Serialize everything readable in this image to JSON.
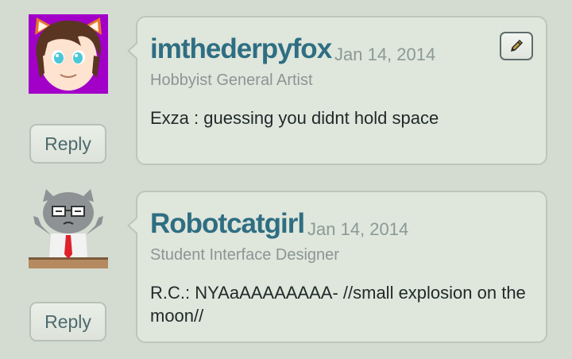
{
  "comments": [
    {
      "username": "imthederpyfox",
      "date": "Jan 14, 2014",
      "role": "Hobbyist General Artist",
      "body": "Exza : guessing you didnt hold space",
      "reply_label": "Reply",
      "avatar_icon": "fox-boy-avatar",
      "edit_icon": "pencil-icon"
    },
    {
      "username": "Robotcatgirl",
      "date": "Jan 14, 2014",
      "role": "Student Interface Designer",
      "body": "R.C.: NYAaAAAAAAAA- //small explosion on the moon//",
      "reply_label": "Reply",
      "avatar_icon": "gray-cat-avatar"
    }
  ],
  "colors": {
    "background": "#d4dcd2",
    "bubble": "#dfe6dc",
    "username": "#2f6e82",
    "avatar1_bg": "#a200c8"
  }
}
